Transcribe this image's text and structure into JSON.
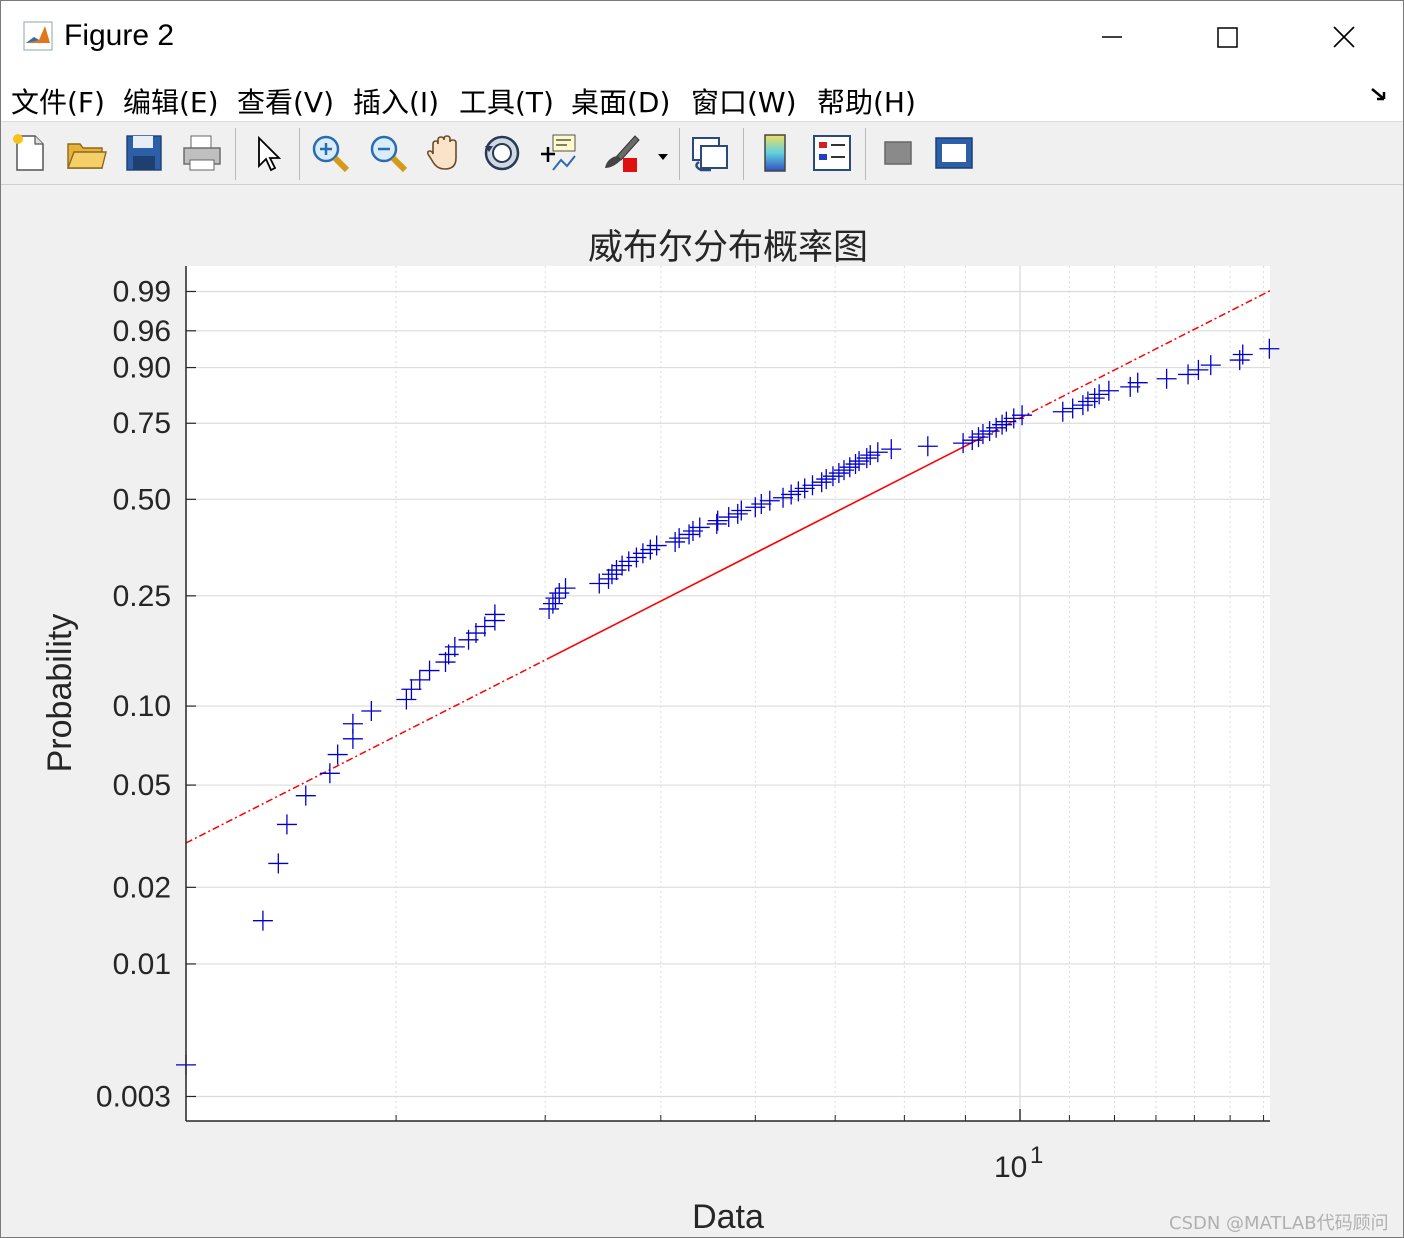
{
  "window": {
    "title": "Figure 2",
    "minimize_label": "minimize",
    "maximize_label": "maximize",
    "close_label": "close"
  },
  "menu": [
    "文件(F)",
    "编辑(E)",
    "查看(V)",
    "插入(I)",
    "工具(T)",
    "桌面(D)",
    "窗口(W)",
    "帮助(H)"
  ],
  "toolbar": {
    "icons": [
      "new-figure-icon",
      "open-file-icon",
      "save-icon",
      "print-icon",
      "select-arrow-icon",
      "zoom-in-icon",
      "zoom-out-icon",
      "pan-hand-icon",
      "rotate-3d-icon",
      "data-cursor-icon",
      "brush-icon",
      "brush-dropdown-icon",
      "link-plot-icon",
      "colorbar-icon",
      "legend-icon",
      "hide-plot-tools-icon",
      "show-plot-tools-icon"
    ]
  },
  "watermark": "CSDN @MATLAB代码顾问",
  "colors": {
    "data_marker": "#0000cc",
    "fit_line": "#ff0000",
    "grid": "#dcdcdc",
    "axes_background": "#ffffff",
    "figure_background": "#f0f0f0"
  },
  "chart_data": {
    "type": "scatter",
    "title": "威布尔分布概率图",
    "xlabel": "Data",
    "ylabel": "Probability",
    "xscale": "log",
    "yscale": "weibull",
    "xlim": [
      2.0,
      16.2
    ],
    "x_tick_labels": [
      {
        "value": 10,
        "base": "10",
        "exponent": "1"
      }
    ],
    "y_ticks": [
      0.003,
      0.01,
      0.02,
      0.05,
      0.1,
      0.25,
      0.5,
      0.75,
      0.9,
      0.96,
      0.99
    ],
    "y_tick_labels": [
      "0.003",
      "0.01",
      "0.02",
      "0.05",
      "0.10",
      "0.25",
      "0.50",
      "0.75",
      "0.90",
      "0.96",
      "0.99"
    ],
    "ylim": [
      0.0024,
      0.997
    ],
    "grid": true,
    "fit_line": {
      "x": [
        2.0,
        16.2
      ],
      "y": [
        0.0298,
        0.9903
      ],
      "color": "#ff0000"
    },
    "points": {
      "x": [
        2.0,
        2.32,
        2.39,
        2.43,
        2.52,
        2.64,
        2.68,
        2.76,
        2.76,
        2.86,
        3.06,
        3.09,
        3.14,
        3.2,
        3.3,
        3.32,
        3.36,
        3.45,
        3.5,
        3.56,
        3.63,
        3.63,
        4.03,
        4.06,
        4.08,
        4.11,
        4.16,
        4.44,
        4.52,
        4.55,
        4.59,
        4.64,
        4.7,
        4.77,
        4.83,
        4.9,
        4.96,
        5.14,
        5.18,
        5.28,
        5.32,
        5.39,
        5.57,
        5.58,
        5.7,
        5.8,
        5.84,
        6.0,
        6.07,
        6.17,
        6.33,
        6.43,
        6.52,
        6.6,
        6.7,
        6.82,
        6.88,
        6.97,
        7.05,
        7.12,
        7.2,
        7.28,
        7.33,
        7.44,
        7.49,
        7.6,
        7.8,
        8.37,
        8.96,
        9.12,
        9.23,
        9.31,
        9.43,
        9.55,
        9.66,
        9.74,
        9.88,
        10.04,
        10.86,
        11.07,
        11.29,
        11.4,
        11.55,
        11.65,
        11.87,
        12.37,
        12.55,
        13.27,
        13.83,
        14.11,
        14.45,
        15.28,
        15.37,
        16.18
      ],
      "y": [
        0.004,
        0.0148,
        0.0248,
        0.0352,
        0.0455,
        0.0555,
        0.0655,
        0.0752,
        0.0858,
        0.0958,
        0.1058,
        0.1156,
        0.1252,
        0.1355,
        0.1456,
        0.1552,
        0.1653,
        0.1753,
        0.1853,
        0.1955,
        0.2052,
        0.2156,
        0.2253,
        0.235,
        0.2455,
        0.2555,
        0.2655,
        0.2752,
        0.2852,
        0.2955,
        0.305,
        0.3153,
        0.3255,
        0.335,
        0.3455,
        0.355,
        0.3655,
        0.375,
        0.3853,
        0.3955,
        0.405,
        0.4152,
        0.4253,
        0.435,
        0.4455,
        0.455,
        0.4652,
        0.4753,
        0.4853,
        0.4955,
        0.505,
        0.5155,
        0.5253,
        0.535,
        0.5452,
        0.5552,
        0.5655,
        0.575,
        0.5855,
        0.5953,
        0.605,
        0.6155,
        0.6255,
        0.6355,
        0.6455,
        0.655,
        0.6655,
        0.675,
        0.6855,
        0.6952,
        0.7052,
        0.7155,
        0.725,
        0.7355,
        0.7455,
        0.755,
        0.7652,
        0.775,
        0.7855,
        0.7952,
        0.805,
        0.8155,
        0.825,
        0.8352,
        0.845,
        0.855,
        0.8655,
        0.875,
        0.885,
        0.895,
        0.905,
        0.915,
        0.9252,
        0.935
      ],
      "marker": "+",
      "color": "#0000cc"
    }
  }
}
